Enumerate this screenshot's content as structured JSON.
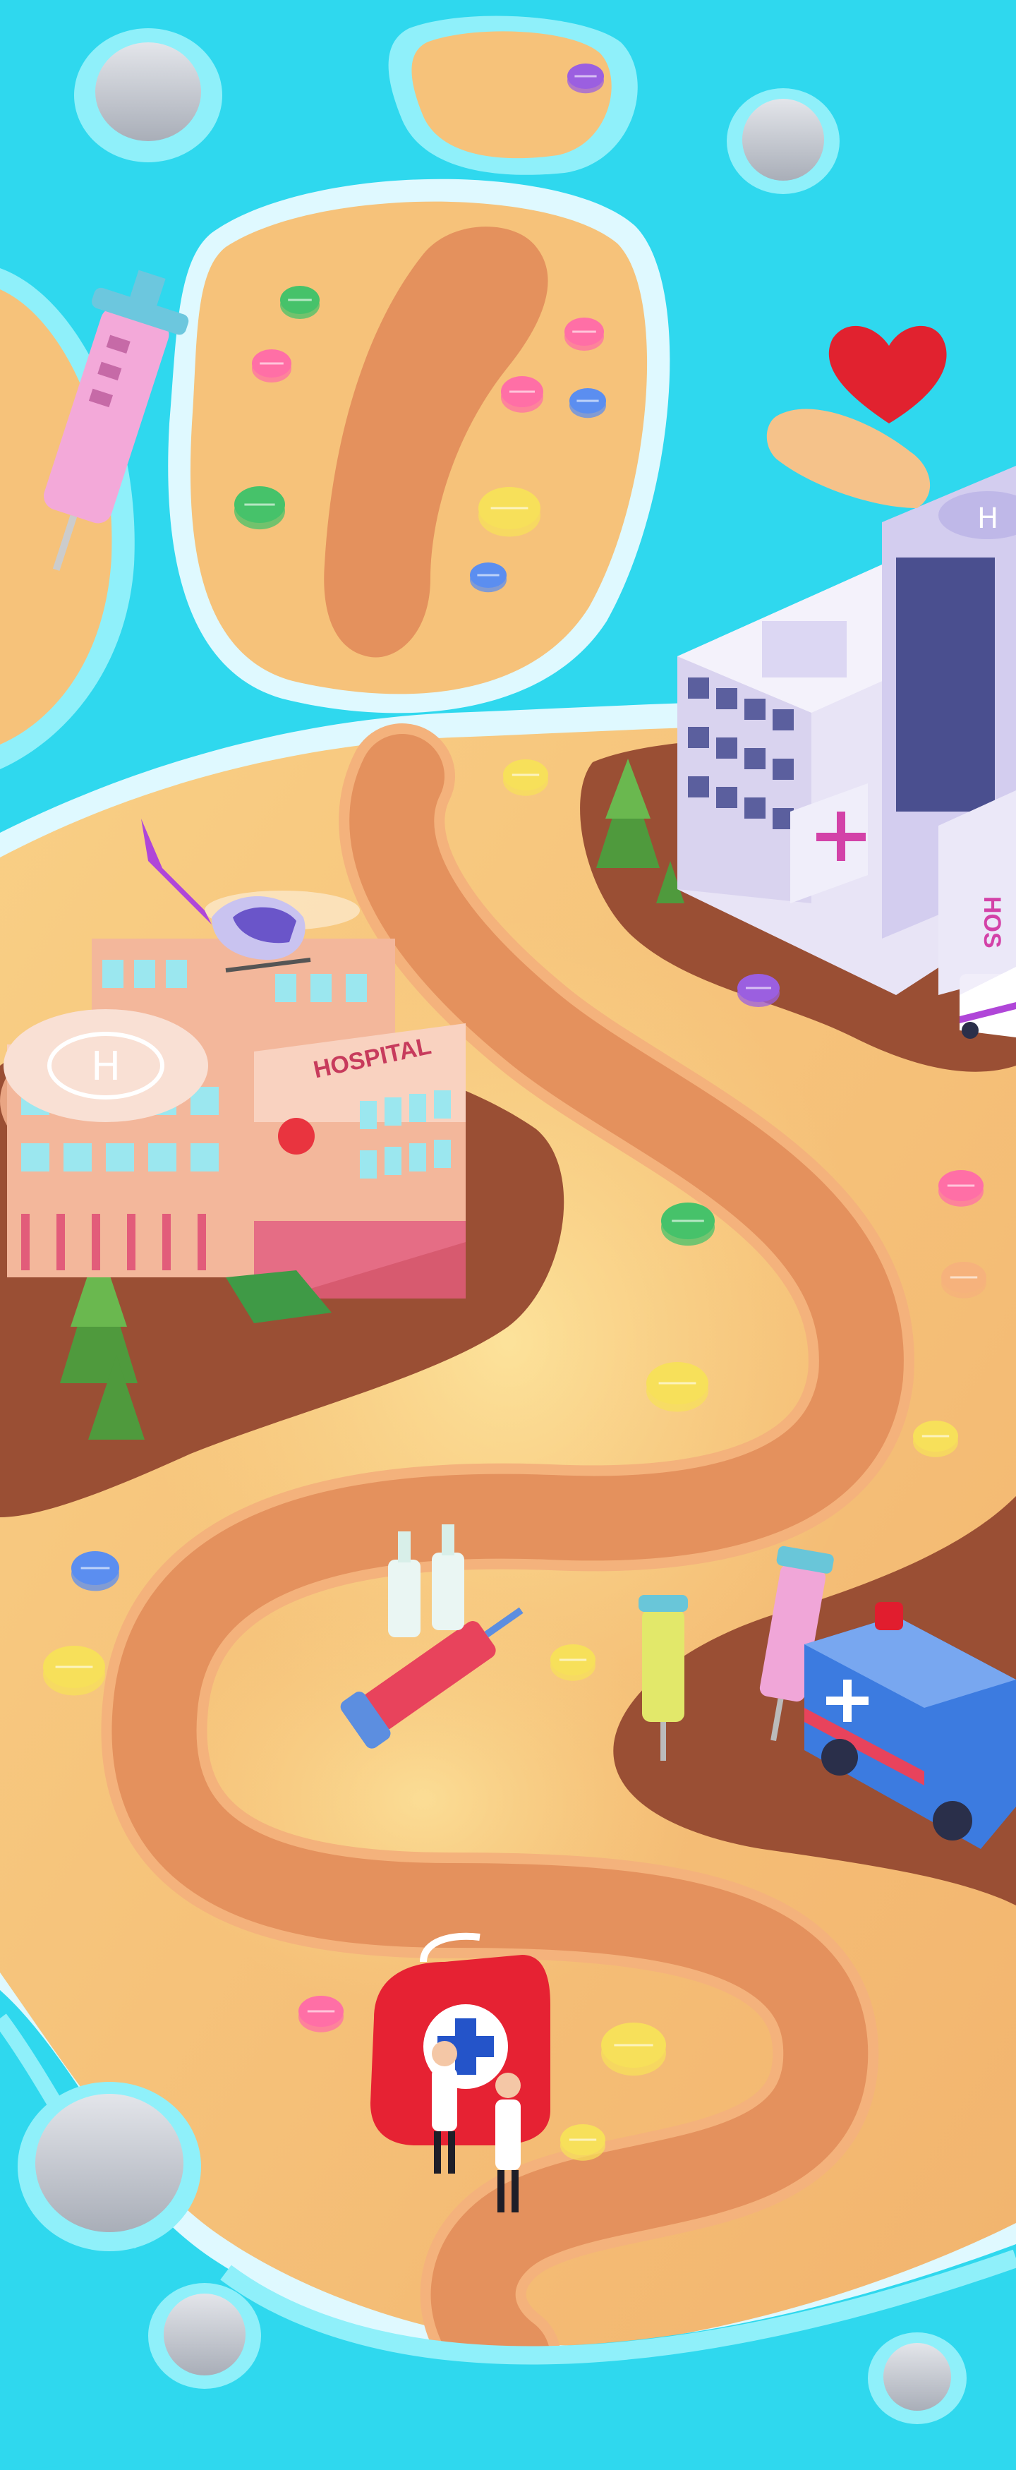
{
  "scene": {
    "type": "game level map",
    "theme": "medical",
    "colors": {
      "water": "#2fd8ee",
      "water_light": "#8ff0fa",
      "foam": "#dff9ff",
      "sand": "#f6c27a",
      "sand_light": "#fbe199",
      "dirt": "#9a4f34",
      "path": "#e4915d",
      "path_edge": "#f4b27c",
      "rock": "#c9cdd6",
      "tree": "#4f9a3d"
    }
  },
  "hospital_left": {
    "sign": "HOSPITAL"
  },
  "hospital_right": {
    "sign": "HOS"
  },
  "pills": [
    {
      "color": "#9b5fe0"
    },
    {
      "color": "#46c26a"
    },
    {
      "color": "#ff6fa6"
    },
    {
      "color": "#ff6fa6"
    },
    {
      "color": "#ff6fa6"
    },
    {
      "color": "#5b8ef0"
    },
    {
      "color": "#46c26a"
    },
    {
      "color": "#f7e05a"
    },
    {
      "color": "#5b8ef0"
    },
    {
      "color": "#f7e05a"
    },
    {
      "color": "#9b5fe0"
    },
    {
      "color": "#ff6fa6"
    },
    {
      "color": "#46c26a"
    },
    {
      "color": "#f6b27c"
    },
    {
      "color": "#f7e05a"
    },
    {
      "color": "#f7e05a"
    },
    {
      "color": "#5b8ef0"
    },
    {
      "color": "#f7e05a"
    },
    {
      "color": "#f7e05a"
    },
    {
      "color": "#ff6fa6"
    },
    {
      "color": "#f7e05a"
    },
    {
      "color": "#f7e05a"
    }
  ]
}
